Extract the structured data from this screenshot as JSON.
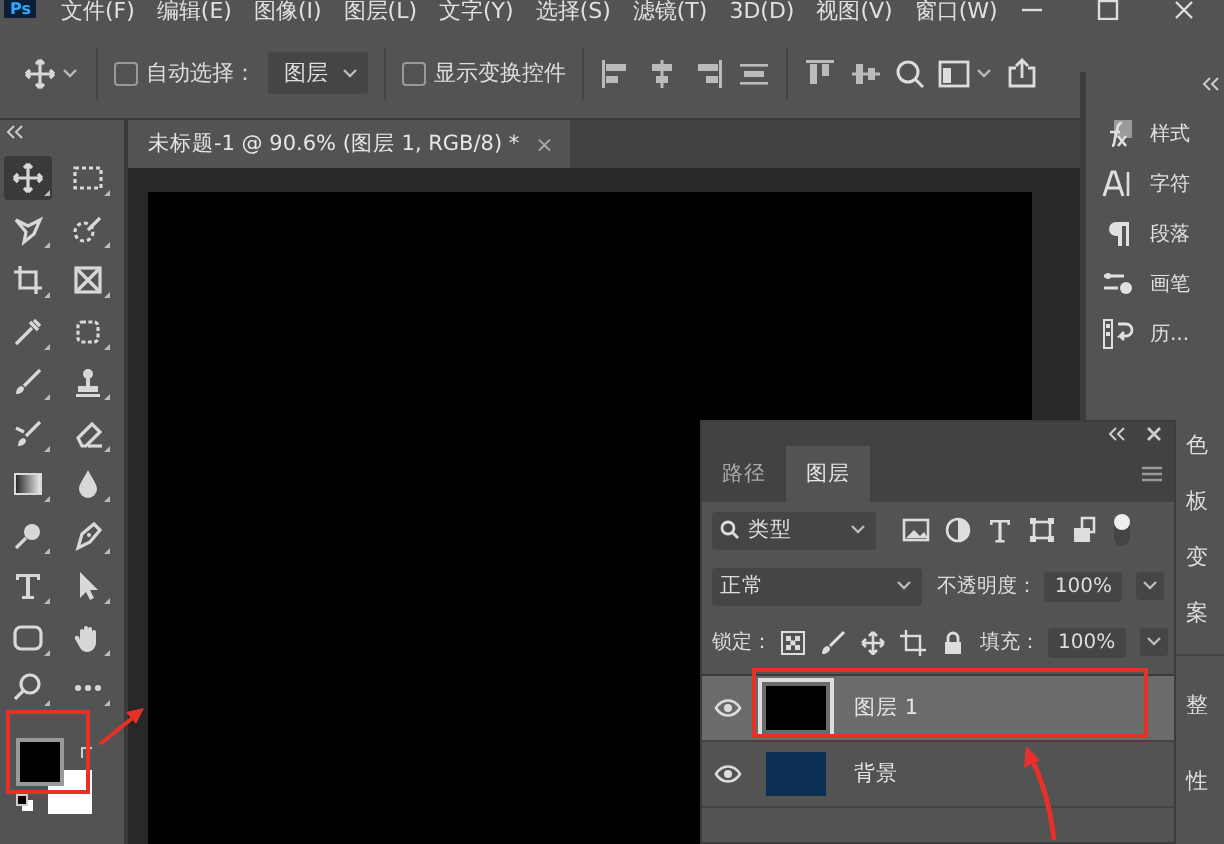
{
  "app_logo": "Ps",
  "menu": [
    "文件(F)",
    "编辑(E)",
    "图像(I)",
    "图层(L)",
    "文字(Y)",
    "选择(S)",
    "滤镜(T)",
    "3D(D)",
    "视图(V)",
    "窗口(W)"
  ],
  "options_bar": {
    "auto_select": {
      "label": "自动选择：",
      "checked": false
    },
    "target": "图层",
    "transform_controls": {
      "label": "显示变换控件",
      "checked": false
    }
  },
  "document_tab": {
    "title": "未标题-1 @ 90.6% (图层 1, RGB/8) *",
    "close": "×"
  },
  "tools": [
    {
      "kind": "move",
      "selected": true
    },
    {
      "kind": "marquee",
      "selected": false
    },
    {
      "kind": "lasso",
      "selected": false
    },
    {
      "kind": "quick-select",
      "selected": false
    },
    {
      "kind": "crop",
      "selected": false
    },
    {
      "kind": "frame",
      "selected": false
    },
    {
      "kind": "eyedropper",
      "selected": false
    },
    {
      "kind": "heal",
      "selected": false
    },
    {
      "kind": "brush",
      "selected": false
    },
    {
      "kind": "stamp",
      "selected": false
    },
    {
      "kind": "history-brush",
      "selected": false
    },
    {
      "kind": "eraser",
      "selected": false
    },
    {
      "kind": "gradient",
      "selected": false
    },
    {
      "kind": "blur",
      "selected": false
    },
    {
      "kind": "dodge",
      "selected": false
    },
    {
      "kind": "pen",
      "selected": false
    },
    {
      "kind": "type",
      "selected": false
    },
    {
      "kind": "path-select",
      "selected": false
    },
    {
      "kind": "shape",
      "selected": false
    },
    {
      "kind": "hand",
      "selected": false
    },
    {
      "kind": "zoom",
      "selected": false
    },
    {
      "kind": "more",
      "selected": false
    }
  ],
  "color_swatches": [
    {
      "kind": "background",
      "color": "#ffffff"
    },
    {
      "kind": "foreground",
      "color": "#000000"
    }
  ],
  "right_panel": {
    "items": [
      {
        "kind": "styles",
        "label": "样式"
      },
      {
        "kind": "character",
        "label": "字符"
      },
      {
        "kind": "paragraph",
        "label": "段落"
      },
      {
        "kind": "brush",
        "label": "画笔"
      },
      {
        "kind": "history",
        "label": "历..."
      }
    ],
    "partial_labels": [
      "色",
      "板",
      "变",
      "案"
    ],
    "lower_partial_labels": [
      "整",
      "性"
    ]
  },
  "layers_panel": {
    "tabs": [
      {
        "label": "路径",
        "selected": false
      },
      {
        "label": "图层",
        "selected": true
      }
    ],
    "filter": "类型",
    "blend_mode": "正常",
    "opacity_label": "不透明度：",
    "opacity": "100%",
    "lock_label": "锁定：",
    "fill_label": "填充：",
    "fill": "100%",
    "layers": [
      {
        "name": "图层 1",
        "visible": true,
        "selected": true,
        "color": "#000000"
      },
      {
        "name": "背景",
        "visible": true,
        "selected": false,
        "color": "#0b2f52"
      }
    ]
  }
}
